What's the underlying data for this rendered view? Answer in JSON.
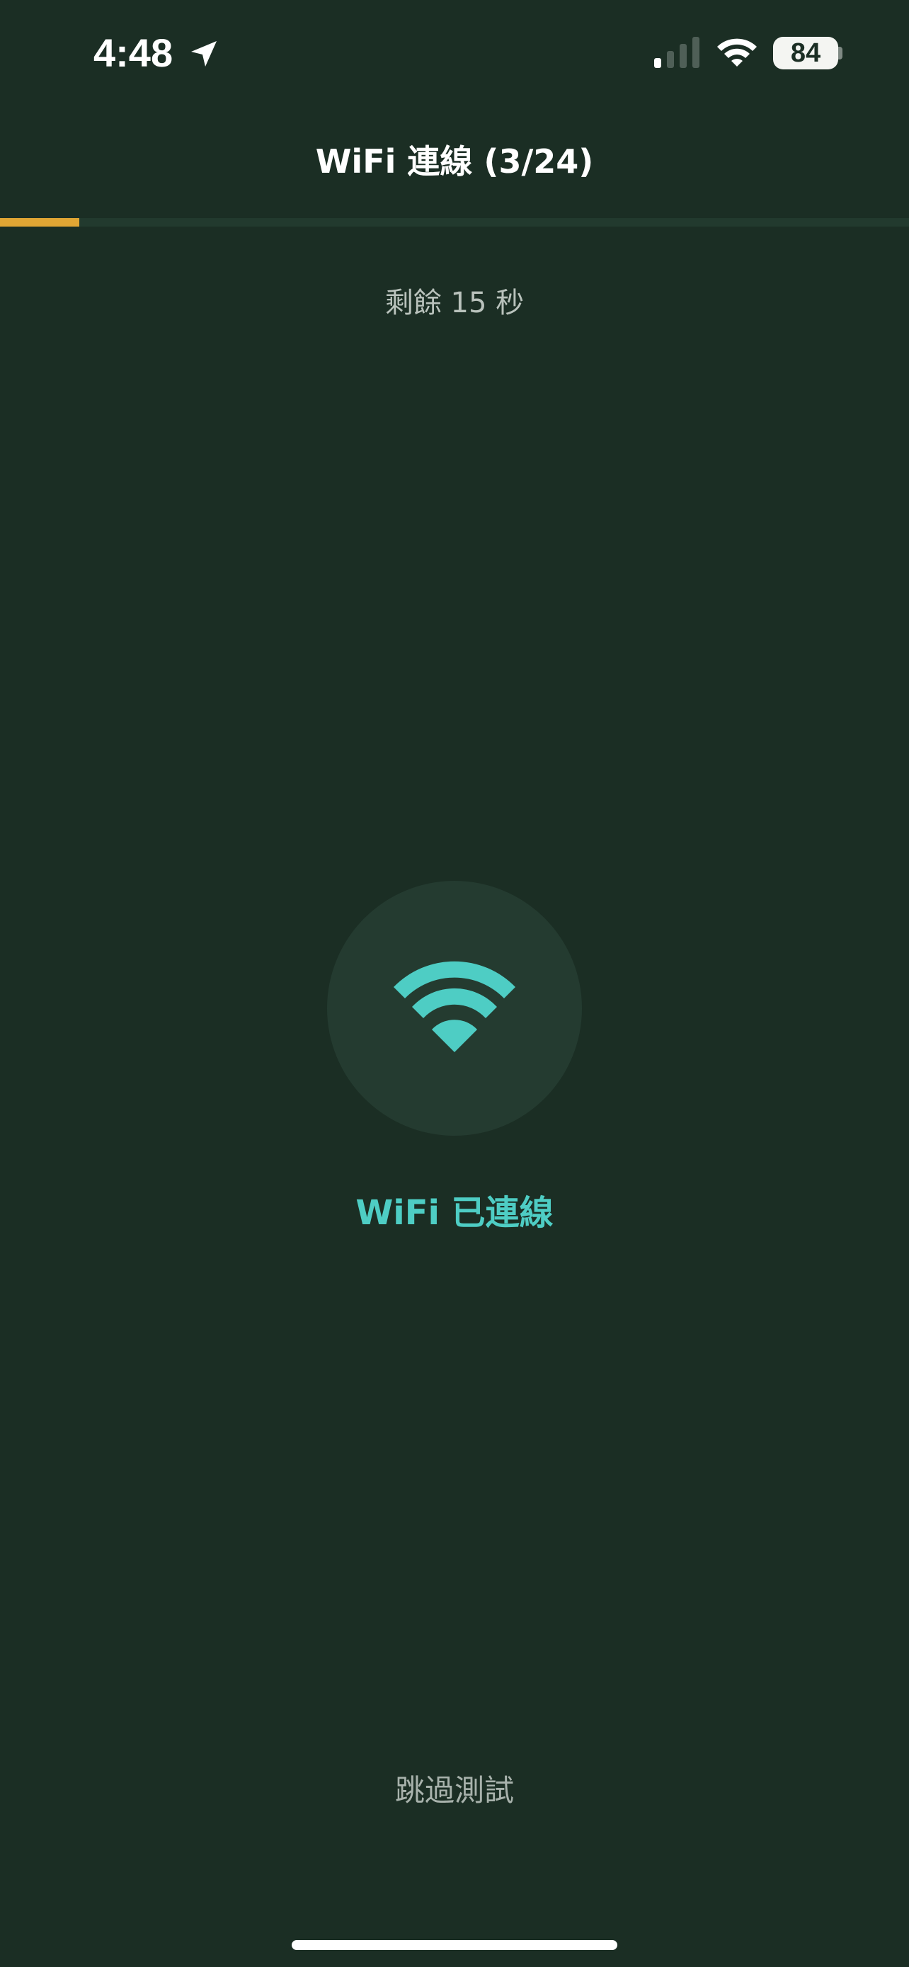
{
  "status_bar": {
    "time": "4:48",
    "battery_level": "84",
    "icons": [
      "location-arrow-icon",
      "cellular-signal-icon",
      "wifi-icon",
      "battery-icon"
    ]
  },
  "header": {
    "title": "WiFi 連線 (3/24)"
  },
  "progress": {
    "current": 3,
    "total": 24,
    "fraction": 0.087,
    "fill_color": "#e0a634"
  },
  "countdown": {
    "text": "剩餘 15 秒"
  },
  "status": {
    "icon": "wifi-icon",
    "label": "WiFi 已連線",
    "accent_color": "#4ecdc4"
  },
  "actions": {
    "skip_label": "跳過測試"
  },
  "colors": {
    "background": "#1b2e24",
    "circle": "#243b30",
    "accent": "#4ecdc4",
    "progress": "#e0a634"
  }
}
